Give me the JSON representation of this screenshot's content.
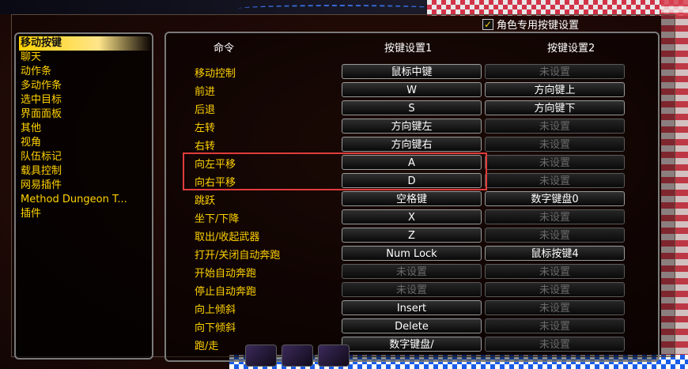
{
  "role_keybinds": {
    "checked": true,
    "label": "角色专用按键设置"
  },
  "categories": [
    {
      "label": "移动按键",
      "selected": true
    },
    {
      "label": "聊天"
    },
    {
      "label": "动作条"
    },
    {
      "label": "多动作条"
    },
    {
      "label": "选中目标"
    },
    {
      "label": "界面面板"
    },
    {
      "label": "其他"
    },
    {
      "label": "视角"
    },
    {
      "label": "队伍标记"
    },
    {
      "label": "载具控制"
    },
    {
      "label": "网易插件"
    },
    {
      "label": "Method Dungeon T..."
    },
    {
      "label": "插件"
    }
  ],
  "columns": {
    "command": "命令",
    "binding1": "按键设置1",
    "binding2": "按键设置2"
  },
  "unset_label": "未设置",
  "bindings": [
    {
      "command": "移动控制",
      "key1": "鼠标中键",
      "key2": "未设置"
    },
    {
      "command": "前进",
      "key1": "W",
      "key2": "方向键上"
    },
    {
      "command": "后退",
      "key1": "S",
      "key2": "方向键下"
    },
    {
      "command": "左转",
      "key1": "方向键左",
      "key2": "未设置"
    },
    {
      "command": "右转",
      "key1": "方向键右",
      "key2": "未设置"
    },
    {
      "command": "向左平移",
      "key1": "A",
      "key2": "未设置"
    },
    {
      "command": "向右平移",
      "key1": "D",
      "key2": "未设置"
    },
    {
      "command": "跳跃",
      "key1": "空格键",
      "key2": "数字键盘0"
    },
    {
      "command": "坐下/下降",
      "key1": "X",
      "key2": "未设置"
    },
    {
      "command": "取出/收起武器",
      "key1": "Z",
      "key2": "未设置"
    },
    {
      "command": "打开/关闭自动奔跑",
      "key1": "Num Lock",
      "key2": "鼠标按键4"
    },
    {
      "command": "开始自动奔跑",
      "key1": "未设置",
      "key2": "未设置"
    },
    {
      "command": "停止自动奔跑",
      "key1": "未设置",
      "key2": "未设置"
    },
    {
      "command": "向上倾斜",
      "key1": "Insert",
      "key2": "未设置"
    },
    {
      "command": "向下倾斜",
      "key1": "Delete",
      "key2": "未设置"
    },
    {
      "command": "跑/走",
      "key1": "数字键盘/",
      "key2": "未设置"
    }
  ],
  "colors": {
    "label": "#ffd200",
    "highlight": "#e03c3c",
    "unset": "#6a6a6a"
  }
}
